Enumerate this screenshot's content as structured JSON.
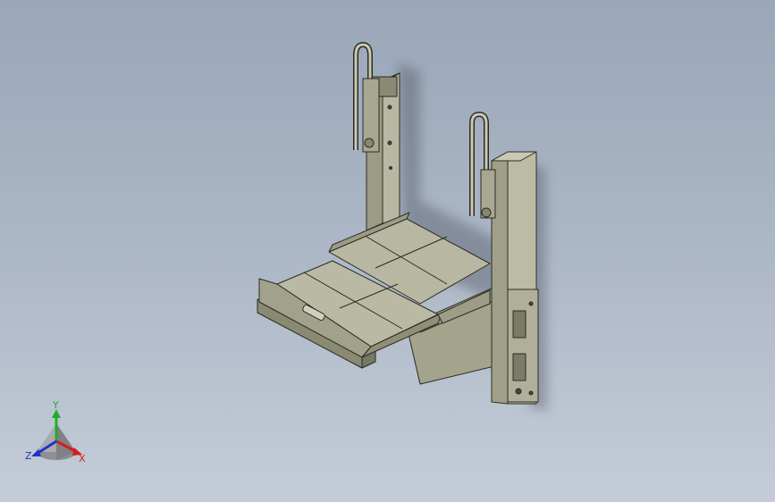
{
  "viewport": {
    "background_top": "#9aa7b8",
    "background_bottom": "#c4ccd7"
  },
  "model": {
    "body_color": "#b2b29c",
    "shade_color": "#8f8f78",
    "edge_color": "#2b2b22"
  },
  "triad": {
    "x_label": "X",
    "y_label": "Y",
    "z_label": "Z",
    "x_color": "#d21e1e",
    "y_color": "#1fae2a",
    "z_color": "#2233cc"
  }
}
